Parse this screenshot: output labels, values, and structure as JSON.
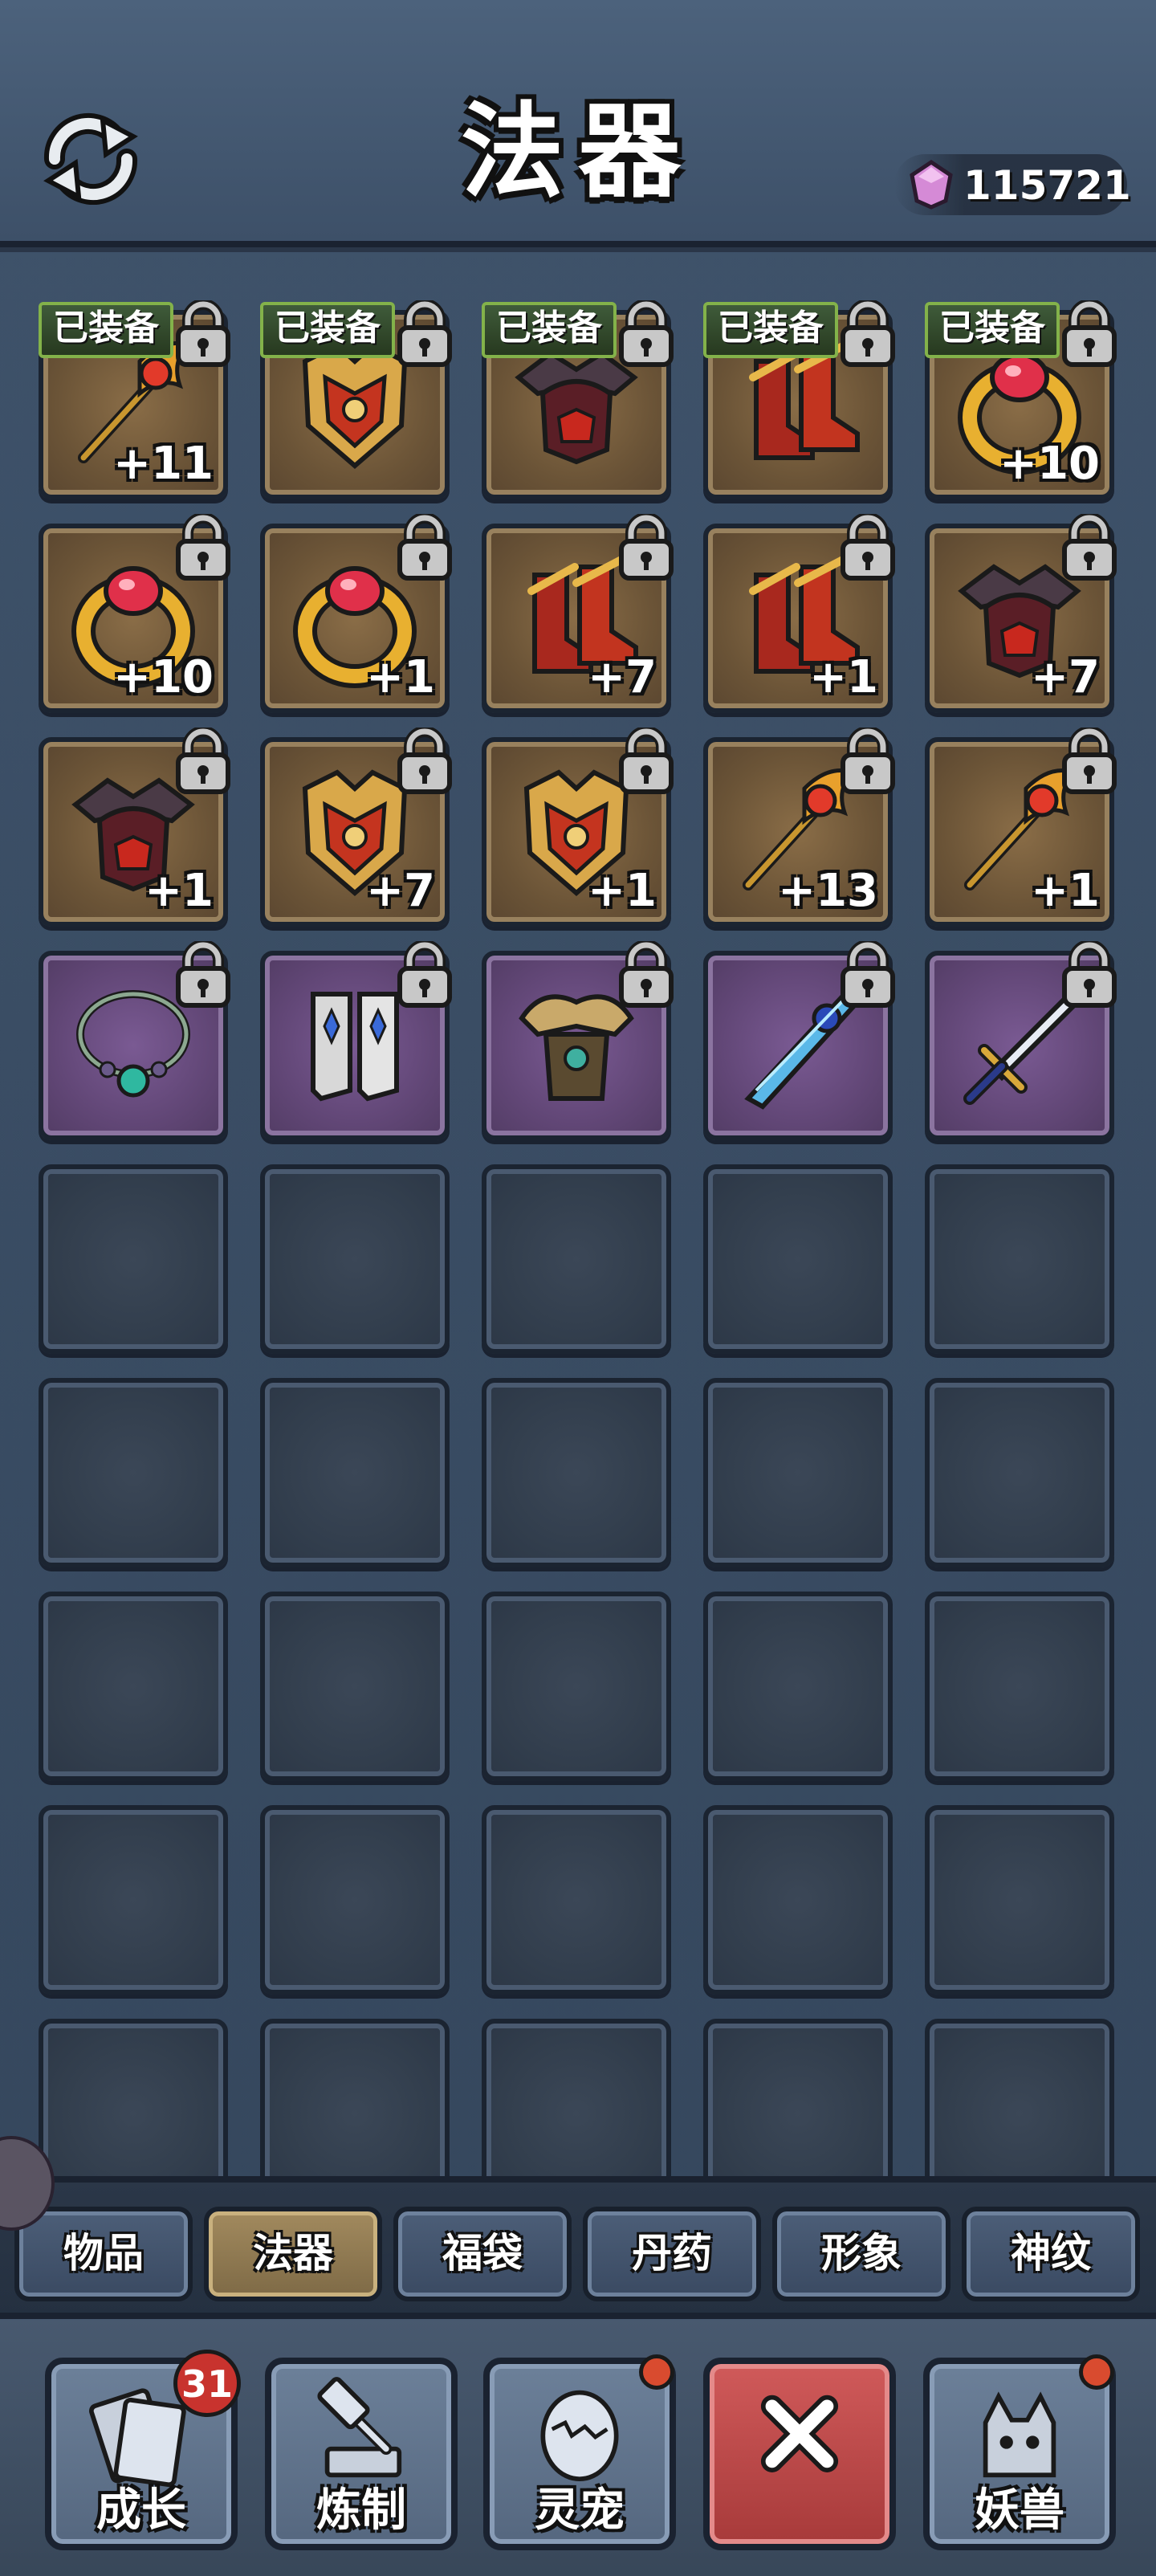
{
  "header": {
    "title": "法器",
    "currency_value": "115721",
    "currency_icon": "crystal-gem-icon"
  },
  "equipped_label": "已装备",
  "grid": {
    "rows": [
      [
        {
          "equipped": true,
          "rarity": "orange",
          "icon": "trident-staff-icon",
          "level": "+11"
        },
        {
          "equipped": true,
          "rarity": "orange",
          "icon": "armor-chestplate-icon",
          "level": ""
        },
        {
          "equipped": true,
          "rarity": "orange",
          "icon": "dark-helmet-icon",
          "level": ""
        },
        {
          "equipped": true,
          "rarity": "orange",
          "icon": "boots-icon",
          "level": ""
        },
        {
          "equipped": true,
          "rarity": "orange",
          "icon": "ruby-ring-icon",
          "level": "+10"
        }
      ],
      [
        {
          "rarity": "orange",
          "icon": "ruby-ring-icon",
          "level": "+10"
        },
        {
          "rarity": "orange",
          "icon": "ruby-ring-icon",
          "level": "+1"
        },
        {
          "rarity": "orange",
          "icon": "boots-icon",
          "level": "+7"
        },
        {
          "rarity": "orange",
          "icon": "boots-icon",
          "level": "+1"
        },
        {
          "rarity": "orange",
          "icon": "dark-helmet-icon",
          "level": "+7"
        }
      ],
      [
        {
          "rarity": "orange",
          "icon": "dark-helmet-icon",
          "level": "+1"
        },
        {
          "rarity": "orange",
          "icon": "armor-chestplate-icon",
          "level": "+7"
        },
        {
          "rarity": "orange",
          "icon": "armor-chestplate-icon",
          "level": "+1"
        },
        {
          "rarity": "orange",
          "icon": "trident-staff-icon",
          "level": "+13"
        },
        {
          "rarity": "orange",
          "icon": "trident-staff-icon",
          "level": "+1"
        }
      ],
      [
        {
          "rarity": "purple",
          "icon": "jade-necklace-icon",
          "level": ""
        },
        {
          "rarity": "purple",
          "icon": "silver-boots-icon",
          "level": ""
        },
        {
          "rarity": "purple",
          "icon": "bronze-armor-icon",
          "level": ""
        },
        {
          "rarity": "purple",
          "icon": "blue-blade-icon",
          "level": ""
        },
        {
          "rarity": "purple",
          "icon": "sword-icon",
          "level": ""
        }
      ]
    ],
    "empty_rows": 5
  },
  "tabs": [
    {
      "label": "物品",
      "active": false
    },
    {
      "label": "法器",
      "active": true
    },
    {
      "label": "福袋",
      "active": false
    },
    {
      "label": "丹药",
      "active": false
    },
    {
      "label": "形象",
      "active": false
    },
    {
      "label": "神纹",
      "active": false
    }
  ],
  "bottom_nav": [
    {
      "label": "成长",
      "icon": "growth-book-icon",
      "badge": "31",
      "dot": false
    },
    {
      "label": "炼制",
      "icon": "forge-hammer-icon",
      "badge": "",
      "dot": false
    },
    {
      "label": "灵宠",
      "icon": "pet-egg-icon",
      "badge": "",
      "dot": true
    },
    {
      "label": "",
      "icon": "close-icon",
      "badge": "",
      "dot": false,
      "close": true
    },
    {
      "label": "妖兽",
      "icon": "demon-beast-icon",
      "badge": "",
      "dot": true
    }
  ]
}
